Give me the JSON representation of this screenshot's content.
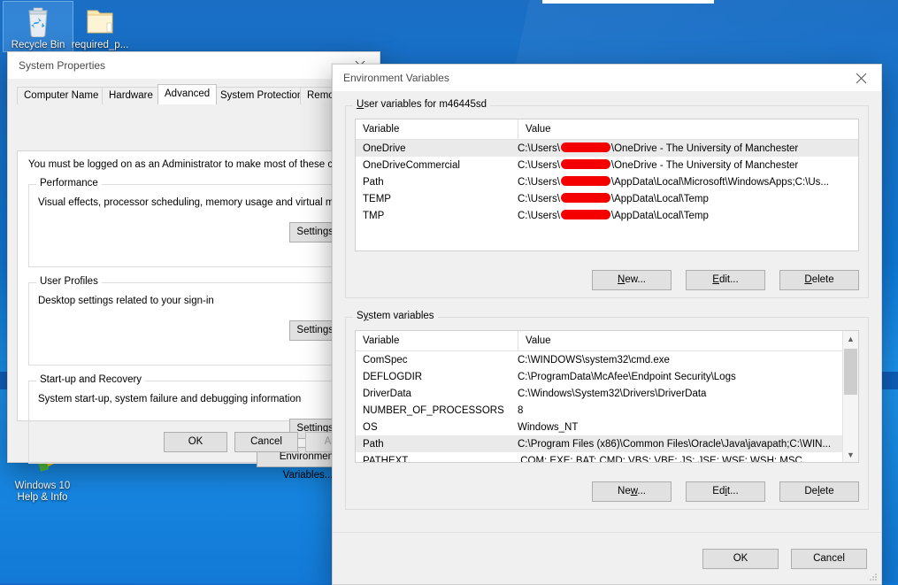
{
  "desktop": {
    "icons": [
      {
        "name": "recycle-bin",
        "label": "Recycle Bin",
        "selected": true
      },
      {
        "name": "folder",
        "label": "required_p...",
        "selected": false
      },
      {
        "name": "help-info",
        "label_line1": "Windows 10",
        "label_line2": "Help & Info"
      }
    ]
  },
  "system_properties": {
    "title": "System Properties",
    "close_label": "close-icon",
    "tabs": [
      {
        "label": "Computer Name",
        "active": false
      },
      {
        "label": "Hardware",
        "active": false
      },
      {
        "label": "Advanced",
        "active": true
      },
      {
        "label": "System Protection",
        "active": false
      },
      {
        "label": "Remote",
        "active": false
      }
    ],
    "hint": "You must be logged on as an Administrator to make most of these changes.",
    "groups": [
      {
        "title": "Performance",
        "desc": "Visual effects, processor scheduling, memory usage and virtual memory",
        "button": "Settings..."
      },
      {
        "title": "User Profiles",
        "desc": "Desktop settings related to your sign-in",
        "button": "Settings..."
      },
      {
        "title": "Start-up and Recovery",
        "desc": "System start-up, system failure and debugging information",
        "button": "Settings..."
      }
    ],
    "environment_variables_button": "Environment Variables...",
    "footer": {
      "ok": "OK",
      "cancel": "Cancel",
      "apply": "Apply"
    }
  },
  "environment_variables": {
    "title": "Environment Variables",
    "close_label": "close-icon",
    "user_section": {
      "legend_prefix": "U",
      "legend_rest": "ser variables for m46445sd",
      "columns": [
        "Variable",
        "Value"
      ],
      "rows": [
        {
          "variable": "OneDrive",
          "value_pre": "C:\\Users\\",
          "redacted": true,
          "value_post": "\\OneDrive - The University of Manchester",
          "selected": true
        },
        {
          "variable": "OneDriveCommercial",
          "value_pre": "C:\\Users\\",
          "redacted": true,
          "value_post": "\\OneDrive - The University of Manchester",
          "selected": false
        },
        {
          "variable": "Path",
          "value_pre": "C:\\Users\\",
          "redacted": true,
          "value_post": "\\AppData\\Local\\Microsoft\\WindowsApps;C:\\Us...",
          "selected": false
        },
        {
          "variable": "TEMP",
          "value_pre": "C:\\Users\\",
          "redacted": true,
          "value_post": "\\AppData\\Local\\Temp",
          "selected": false
        },
        {
          "variable": "TMP",
          "value_pre": "C:\\Users\\",
          "redacted": true,
          "value_post": "\\AppData\\Local\\Temp",
          "selected": false
        }
      ],
      "buttons": [
        {
          "pre": "",
          "acc": "N",
          "post": "ew..."
        },
        {
          "pre": "",
          "acc": "E",
          "post": "dit..."
        },
        {
          "pre": "",
          "acc": "D",
          "post": "elete"
        }
      ]
    },
    "system_section": {
      "legend_prefix": "S",
      "legend_acc": "y",
      "legend_rest": "stem variables",
      "columns": [
        "Variable",
        "Value"
      ],
      "rows": [
        {
          "variable": "ComSpec",
          "value": "C:\\WINDOWS\\system32\\cmd.exe",
          "selected": false
        },
        {
          "variable": "DEFLOGDIR",
          "value": "C:\\ProgramData\\McAfee\\Endpoint Security\\Logs",
          "selected": false
        },
        {
          "variable": "DriverData",
          "value": "C:\\Windows\\System32\\Drivers\\DriverData",
          "selected": false
        },
        {
          "variable": "NUMBER_OF_PROCESSORS",
          "value": "8",
          "selected": false
        },
        {
          "variable": "OS",
          "value": "Windows_NT",
          "selected": false
        },
        {
          "variable": "Path",
          "value": "C:\\Program Files (x86)\\Common Files\\Oracle\\Java\\javapath;C:\\WIN...",
          "selected": true
        },
        {
          "variable": "PATHEXT",
          "value": ".COM;.EXE;.BAT;.CMD;.VBS;.VBE;.JS;.JSE;.WSF;.WSH;.MSC",
          "selected": false
        }
      ],
      "buttons": [
        {
          "pre": "Ne",
          "acc": "w",
          "post": "..."
        },
        {
          "pre": "Ed",
          "acc": "i",
          "post": "t..."
        },
        {
          "pre": "De",
          "acc": "l",
          "post": "ete"
        }
      ],
      "scroll_up": "▲",
      "scroll_down": "▼"
    },
    "footer": {
      "ok": "OK",
      "cancel": "Cancel"
    }
  },
  "colors": {
    "desktop_blue": "#0f79d8",
    "dialog_face": "#f0f0f0",
    "button_face": "#e1e1e1",
    "redaction_red": "#f50000",
    "row_selected": "#eaeaea"
  }
}
